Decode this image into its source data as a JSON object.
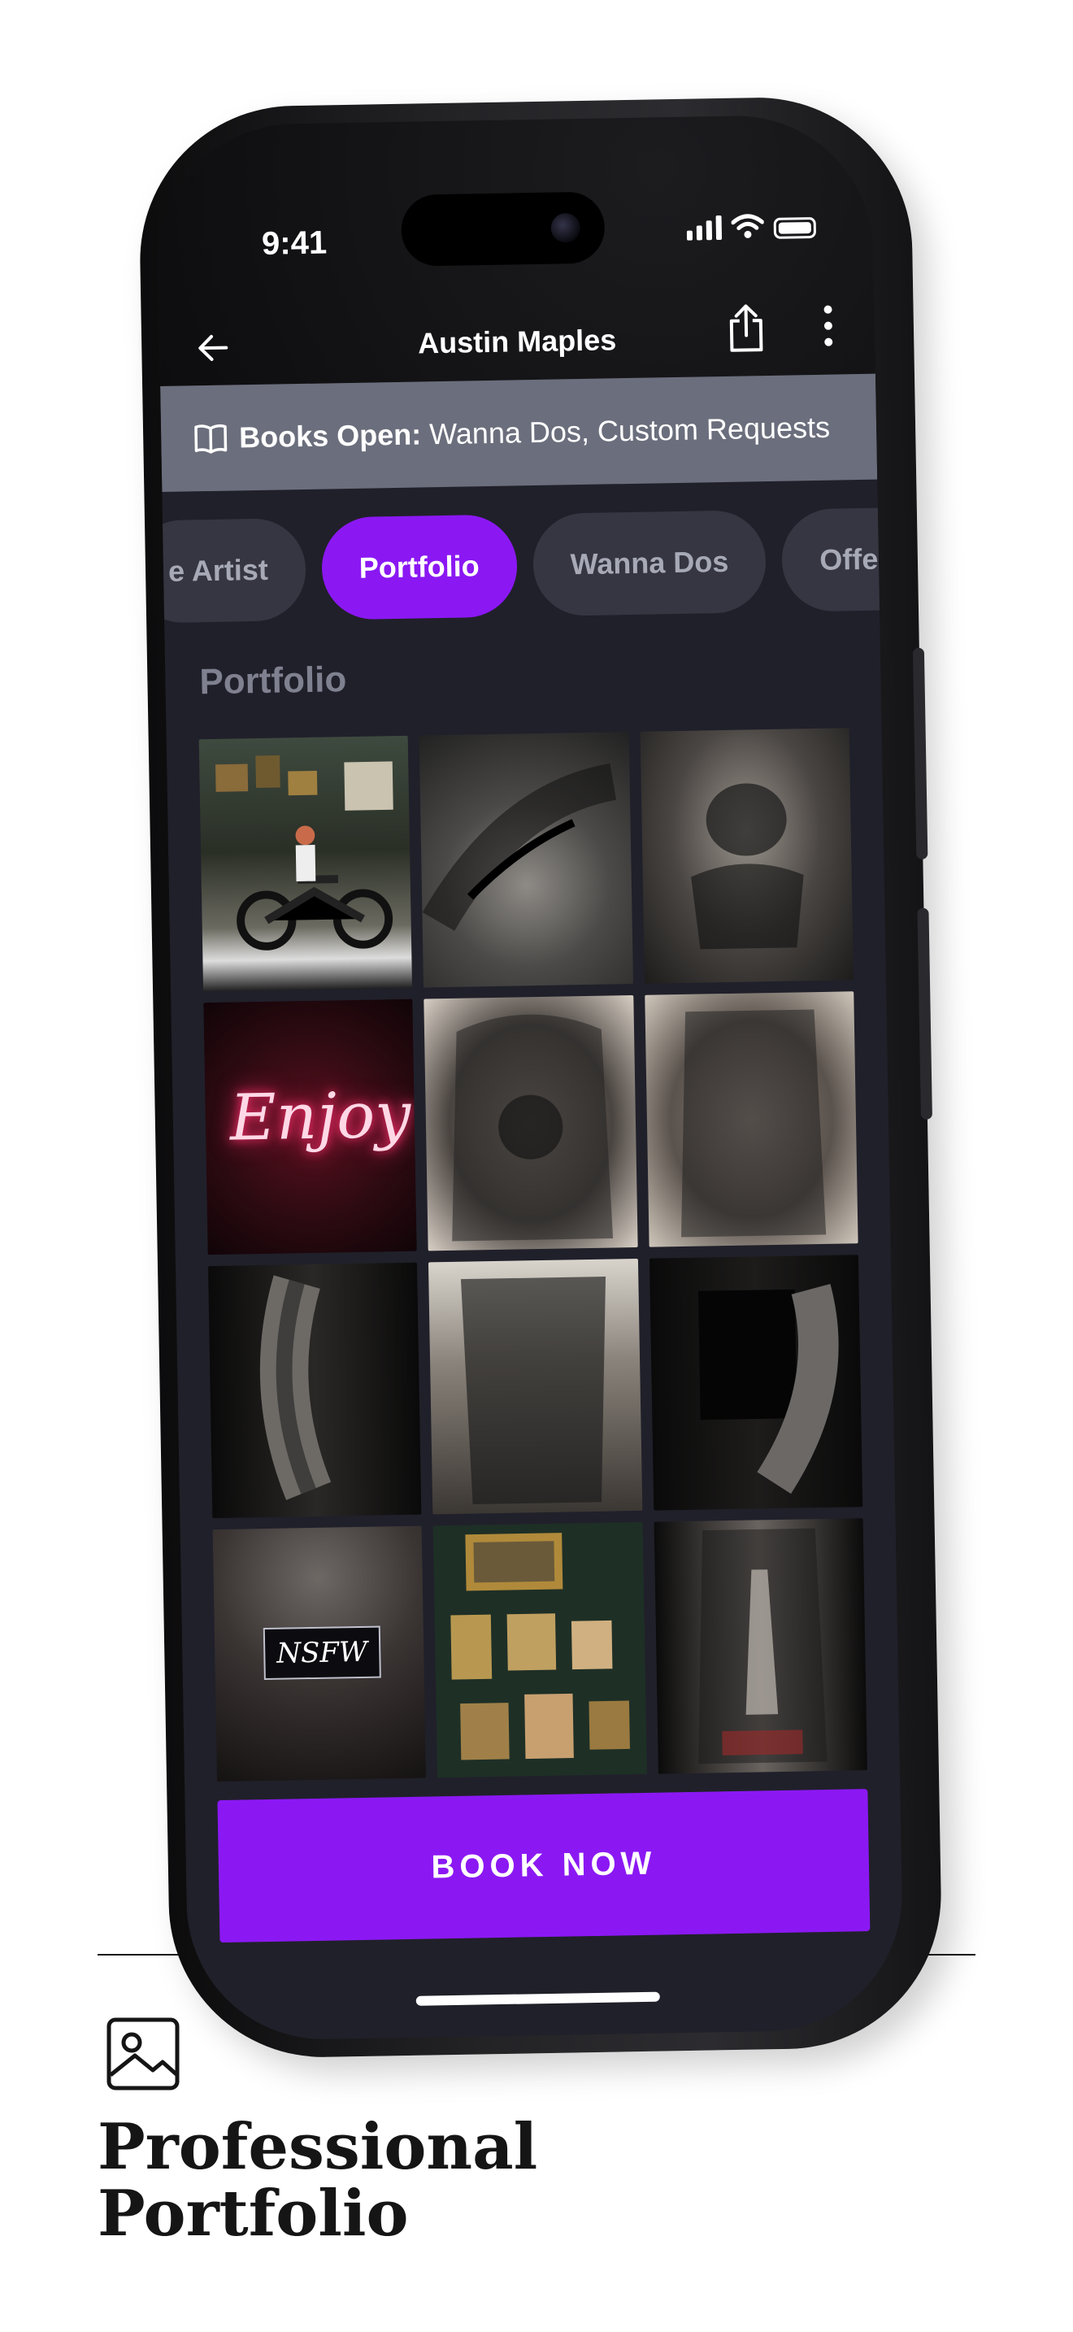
{
  "status_bar": {
    "time": "9:41"
  },
  "header": {
    "title": "Austin Maples"
  },
  "banner": {
    "label": "Books Open:",
    "value": "Wanna Dos, Custom Requests"
  },
  "tabs": [
    {
      "label": "e Artist",
      "active": false
    },
    {
      "label": "Portfolio",
      "active": true
    },
    {
      "label": "Wanna Dos",
      "active": false
    },
    {
      "label": "Offerin",
      "active": false
    }
  ],
  "section": {
    "title": "Portfolio"
  },
  "grid": {
    "nsfw_label": "NSFW",
    "neon_text": "Enjoy"
  },
  "cta": {
    "label": "BOOK NOW"
  },
  "footer": {
    "title_line1": "Professional",
    "title_line2": "Portfolio"
  },
  "colors": {
    "accent": "#8b18f3",
    "screen_bg": "#20202a",
    "banner_bg": "#6b6e7c",
    "tab_bg": "#353641"
  },
  "icons": [
    "back-arrow-icon",
    "share-icon",
    "more-vertical-icon",
    "book-icon",
    "image-icon",
    "wifi-icon",
    "signal-icon",
    "battery-icon"
  ]
}
